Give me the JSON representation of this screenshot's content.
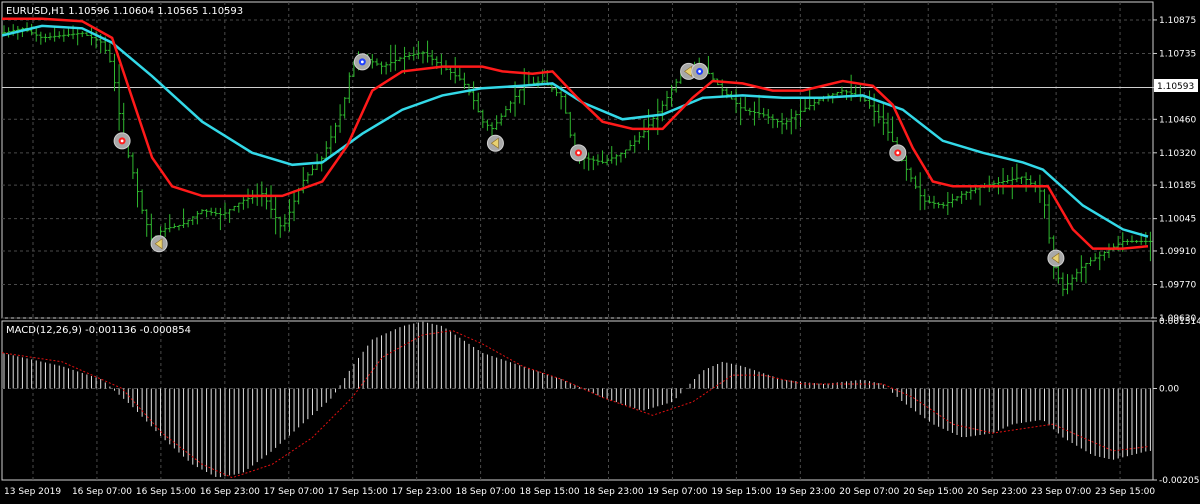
{
  "main_chart": {
    "header": "EURUSD,H1  1.10596 1.10604 1.10565 1.10593",
    "symbol": "EURUSD",
    "timeframe": "H1",
    "ohlc": {
      "open": 1.10596,
      "high": 1.10604,
      "low": 1.10565,
      "close": 1.10593
    },
    "price_levels": [
      "1.10875",
      "1.10735",
      "1.10593",
      "1.10460",
      "1.10320",
      "1.10185",
      "1.10045",
      "1.09910",
      "1.09770",
      "1.09630"
    ],
    "current_price": "1.10593"
  },
  "macd_panel": {
    "header": "MACD(12,26,9) -0.001136 -0.000854",
    "levels": [
      "0.001514",
      "0.00",
      "-0.002052"
    ]
  },
  "time_axis": [
    "13 Sep 2019",
    "16 Sep 07:00",
    "16 Sep 15:00",
    "16 Sep 23:00",
    "17 Sep 07:00",
    "17 Sep 15:00",
    "17 Sep 23:00",
    "18 Sep 07:00",
    "18 Sep 15:00",
    "18 Sep 23:00",
    "19 Sep 07:00",
    "19 Sep 15:00",
    "19 Sep 23:00",
    "20 Sep 07:00",
    "20 Sep 15:00",
    "20 Sep 23:00",
    "23 Sep 07:00",
    "23 Sep 15:00"
  ],
  "colors": {
    "background": "#000000",
    "grid": "#4a4a4a",
    "bars": "#2fb82f",
    "slow_ma": "#33d9e8",
    "fast_ma": "#ff1a1a",
    "macd_hist": "#e0e0e0",
    "macd_signal": "#e01010",
    "current_price_line": "#d0d0d0",
    "price_label_bg": "#ffffff"
  },
  "chart_data": [
    {
      "type": "candlestick-bars",
      "title": "EURUSD,H1",
      "x_range": [
        "13 Sep 2019",
        "23 Sep 15:00"
      ],
      "ylim": [
        1.0963,
        1.1095
      ],
      "series": [
        {
          "values": [
            [
              0,
              1.1082
            ],
            [
              20,
              1.1084
            ],
            [
              40,
              1.108
            ],
            [
              60,
              1.1081
            ],
            [
              80,
              1.1082
            ],
            [
              100,
              1.1078
            ],
            [
              110,
              1.1068
            ],
            [
              120,
              1.104
            ],
            [
              130,
              1.1025
            ],
            [
              140,
              1.1008
            ],
            [
              150,
              1.0995
            ],
            [
              160,
              1.1
            ],
            [
              180,
              1.1002
            ],
            [
              200,
              1.1008
            ],
            [
              220,
              1.1006
            ],
            [
              240,
              1.1012
            ],
            [
              260,
              1.1015
            ],
            [
              280,
              1.1
            ],
            [
              300,
              1.102
            ],
            [
              320,
              1.103
            ],
            [
              340,
              1.105
            ],
            [
              350,
              1.107
            ],
            [
              360,
              1.1072
            ],
            [
              380,
              1.1068
            ],
            [
              400,
              1.1072
            ],
            [
              420,
              1.1074
            ],
            [
              440,
              1.1068
            ],
            [
              460,
              1.1062
            ],
            [
              470,
              1.1055
            ],
            [
              480,
              1.1045
            ],
            [
              490,
              1.1042
            ],
            [
              500,
              1.1048
            ],
            [
              520,
              1.106
            ],
            [
              540,
              1.1062
            ],
            [
              560,
              1.1055
            ],
            [
              570,
              1.1035
            ],
            [
              580,
              1.103
            ],
            [
              600,
              1.1028
            ],
            [
              620,
              1.1032
            ],
            [
              640,
              1.104
            ],
            [
              660,
              1.1052
            ],
            [
              680,
              1.1066
            ],
            [
              700,
              1.1068
            ],
            [
              720,
              1.1058
            ],
            [
              740,
              1.105
            ],
            [
              760,
              1.1048
            ],
            [
              780,
              1.1044
            ],
            [
              800,
              1.105
            ],
            [
              820,
              1.1055
            ],
            [
              840,
              1.1058
            ],
            [
              860,
              1.1055
            ],
            [
              880,
              1.1045
            ],
            [
              900,
              1.1028
            ],
            [
              920,
              1.1012
            ],
            [
              940,
              1.101
            ],
            [
              960,
              1.1015
            ],
            [
              980,
              1.1018
            ],
            [
              1000,
              1.102
            ],
            [
              1020,
              1.1022
            ],
            [
              1040,
              1.1015
            ],
            [
              1050,
              1.0985
            ],
            [
              1060,
              1.0975
            ],
            [
              1080,
              1.0985
            ],
            [
              1100,
              1.099
            ],
            [
              1120,
              1.0995
            ],
            [
              1140,
              1.0995
            ]
          ]
        },
        {
          "name": "MA slow",
          "values": [
            [
              0,
              1.1081
            ],
            [
              40,
              1.1085
            ],
            [
              80,
              1.1084
            ],
            [
              110,
              1.1078
            ],
            [
              150,
              1.1064
            ],
            [
              200,
              1.1045
            ],
            [
              250,
              1.1032
            ],
            [
              290,
              1.1027
            ],
            [
              320,
              1.1028
            ],
            [
              360,
              1.104
            ],
            [
              400,
              1.105
            ],
            [
              440,
              1.1056
            ],
            [
              480,
              1.1059
            ],
            [
              520,
              1.106
            ],
            [
              550,
              1.1061
            ],
            [
              580,
              1.1053
            ],
            [
              620,
              1.1046
            ],
            [
              660,
              1.1048
            ],
            [
              700,
              1.1055
            ],
            [
              740,
              1.1056
            ],
            [
              780,
              1.1055
            ],
            [
              820,
              1.1055
            ],
            [
              860,
              1.1056
            ],
            [
              900,
              1.105
            ],
            [
              940,
              1.1037
            ],
            [
              980,
              1.1032
            ],
            [
              1020,
              1.1028
            ],
            [
              1040,
              1.1025
            ],
            [
              1080,
              1.101
            ],
            [
              1120,
              1.1
            ],
            [
              1145,
              1.0997
            ]
          ]
        },
        {
          "name": "MA fast",
          "values": [
            [
              0,
              1.1088
            ],
            [
              40,
              1.1088
            ],
            [
              80,
              1.1087
            ],
            [
              110,
              1.108
            ],
            [
              130,
              1.1055
            ],
            [
              150,
              1.103
            ],
            [
              170,
              1.1018
            ],
            [
              200,
              1.1014
            ],
            [
              240,
              1.1014
            ],
            [
              280,
              1.1014
            ],
            [
              320,
              1.102
            ],
            [
              345,
              1.1035
            ],
            [
              370,
              1.1058
            ],
            [
              400,
              1.1066
            ],
            [
              440,
              1.1068
            ],
            [
              480,
              1.1068
            ],
            [
              500,
              1.1066
            ],
            [
              530,
              1.1065
            ],
            [
              550,
              1.1066
            ],
            [
              575,
              1.1055
            ],
            [
              600,
              1.1045
            ],
            [
              630,
              1.1042
            ],
            [
              660,
              1.1042
            ],
            [
              690,
              1.1055
            ],
            [
              710,
              1.1062
            ],
            [
              740,
              1.1061
            ],
            [
              770,
              1.1058
            ],
            [
              800,
              1.1058
            ],
            [
              840,
              1.1062
            ],
            [
              870,
              1.106
            ],
            [
              890,
              1.1052
            ],
            [
              910,
              1.1034
            ],
            [
              930,
              1.102
            ],
            [
              950,
              1.1018
            ],
            [
              980,
              1.1018
            ],
            [
              1020,
              1.1018
            ],
            [
              1045,
              1.1018
            ],
            [
              1070,
              1.1
            ],
            [
              1090,
              1.0992
            ],
            [
              1120,
              1.0992
            ],
            [
              1145,
              1.0993
            ]
          ]
        }
      ]
    },
    {
      "type": "bar",
      "title": "MACD(12,26,9)",
      "ylim": [
        -0.002052,
        0.001514
      ],
      "series": [
        {
          "name": "histogram",
          "values": [
            [
              0,
              0.0008
            ],
            [
              60,
              0.0005
            ],
            [
              100,
              0.0002
            ],
            [
              130,
              -0.0004
            ],
            [
              160,
              -0.0011
            ],
            [
              190,
              -0.0017
            ],
            [
              215,
              -0.002
            ],
            [
              240,
              -0.0019
            ],
            [
              270,
              -0.0014
            ],
            [
              300,
              -0.0008
            ],
            [
              330,
              -0.0002
            ],
            [
              350,
              0.0005
            ],
            [
              370,
              0.0011
            ],
            [
              400,
              0.0014
            ],
            [
              420,
              0.0015
            ],
            [
              440,
              0.0014
            ],
            [
              460,
              0.0011
            ],
            [
              480,
              0.0008
            ],
            [
              520,
              0.0005
            ],
            [
              560,
              0.0002
            ],
            [
              600,
              -0.0002
            ],
            [
              640,
              -0.0005
            ],
            [
              670,
              -0.0003
            ],
            [
              700,
              0.0004
            ],
            [
              720,
              0.0006
            ],
            [
              740,
              0.0005
            ],
            [
              780,
              0.0002
            ],
            [
              820,
              0.0001
            ],
            [
              860,
              0.0002
            ],
            [
              880,
              0.0001
            ],
            [
              900,
              -0.0003
            ],
            [
              930,
              -0.0008
            ],
            [
              960,
              -0.0011
            ],
            [
              990,
              -0.001
            ],
            [
              1010,
              -0.0008
            ],
            [
              1040,
              -0.0007
            ],
            [
              1060,
              -0.0011
            ],
            [
              1090,
              -0.0015
            ],
            [
              1110,
              -0.0016
            ],
            [
              1145,
              -0.0014
            ]
          ]
        },
        {
          "name": "signal",
          "values": [
            [
              0,
              0.0008
            ],
            [
              60,
              0.0006
            ],
            [
              120,
              0.0
            ],
            [
              160,
              -0.001
            ],
            [
              200,
              -0.0017
            ],
            [
              230,
              -0.002
            ],
            [
              270,
              -0.0017
            ],
            [
              310,
              -0.0011
            ],
            [
              350,
              -0.0002
            ],
            [
              380,
              0.0007
            ],
            [
              420,
              0.0012
            ],
            [
              450,
              0.0013
            ],
            [
              480,
              0.001
            ],
            [
              520,
              0.0005
            ],
            [
              560,
              0.0002
            ],
            [
              600,
              -0.0002
            ],
            [
              650,
              -0.0006
            ],
            [
              690,
              -0.0003
            ],
            [
              730,
              0.0003
            ],
            [
              760,
              0.0003
            ],
            [
              800,
              0.0001
            ],
            [
              840,
              0.0001
            ],
            [
              880,
              0.0001
            ],
            [
              910,
              -0.0002
            ],
            [
              950,
              -0.0008
            ],
            [
              990,
              -0.001
            ],
            [
              1020,
              -0.0009
            ],
            [
              1050,
              -0.0008
            ],
            [
              1080,
              -0.0011
            ],
            [
              1110,
              -0.0014
            ],
            [
              1145,
              -0.0013
            ]
          ]
        }
      ]
    }
  ],
  "signals": [
    {
      "x": 120,
      "price": 1.1037,
      "type": "buy-dot"
    },
    {
      "x": 157,
      "price": 1.0994,
      "type": "arrow-left"
    },
    {
      "x": 360,
      "price": 1.107,
      "type": "sell-dot"
    },
    {
      "x": 493,
      "price": 1.1036,
      "type": "arrow-left"
    },
    {
      "x": 576,
      "price": 1.1032,
      "type": "buy-dot"
    },
    {
      "x": 686,
      "price": 1.1066,
      "type": "arrow-left"
    },
    {
      "x": 697,
      "price": 1.1066,
      "type": "sell-dot"
    },
    {
      "x": 895,
      "price": 1.1032,
      "type": "buy-dot"
    },
    {
      "x": 1053,
      "price": 1.0988,
      "type": "arrow-left"
    }
  ]
}
